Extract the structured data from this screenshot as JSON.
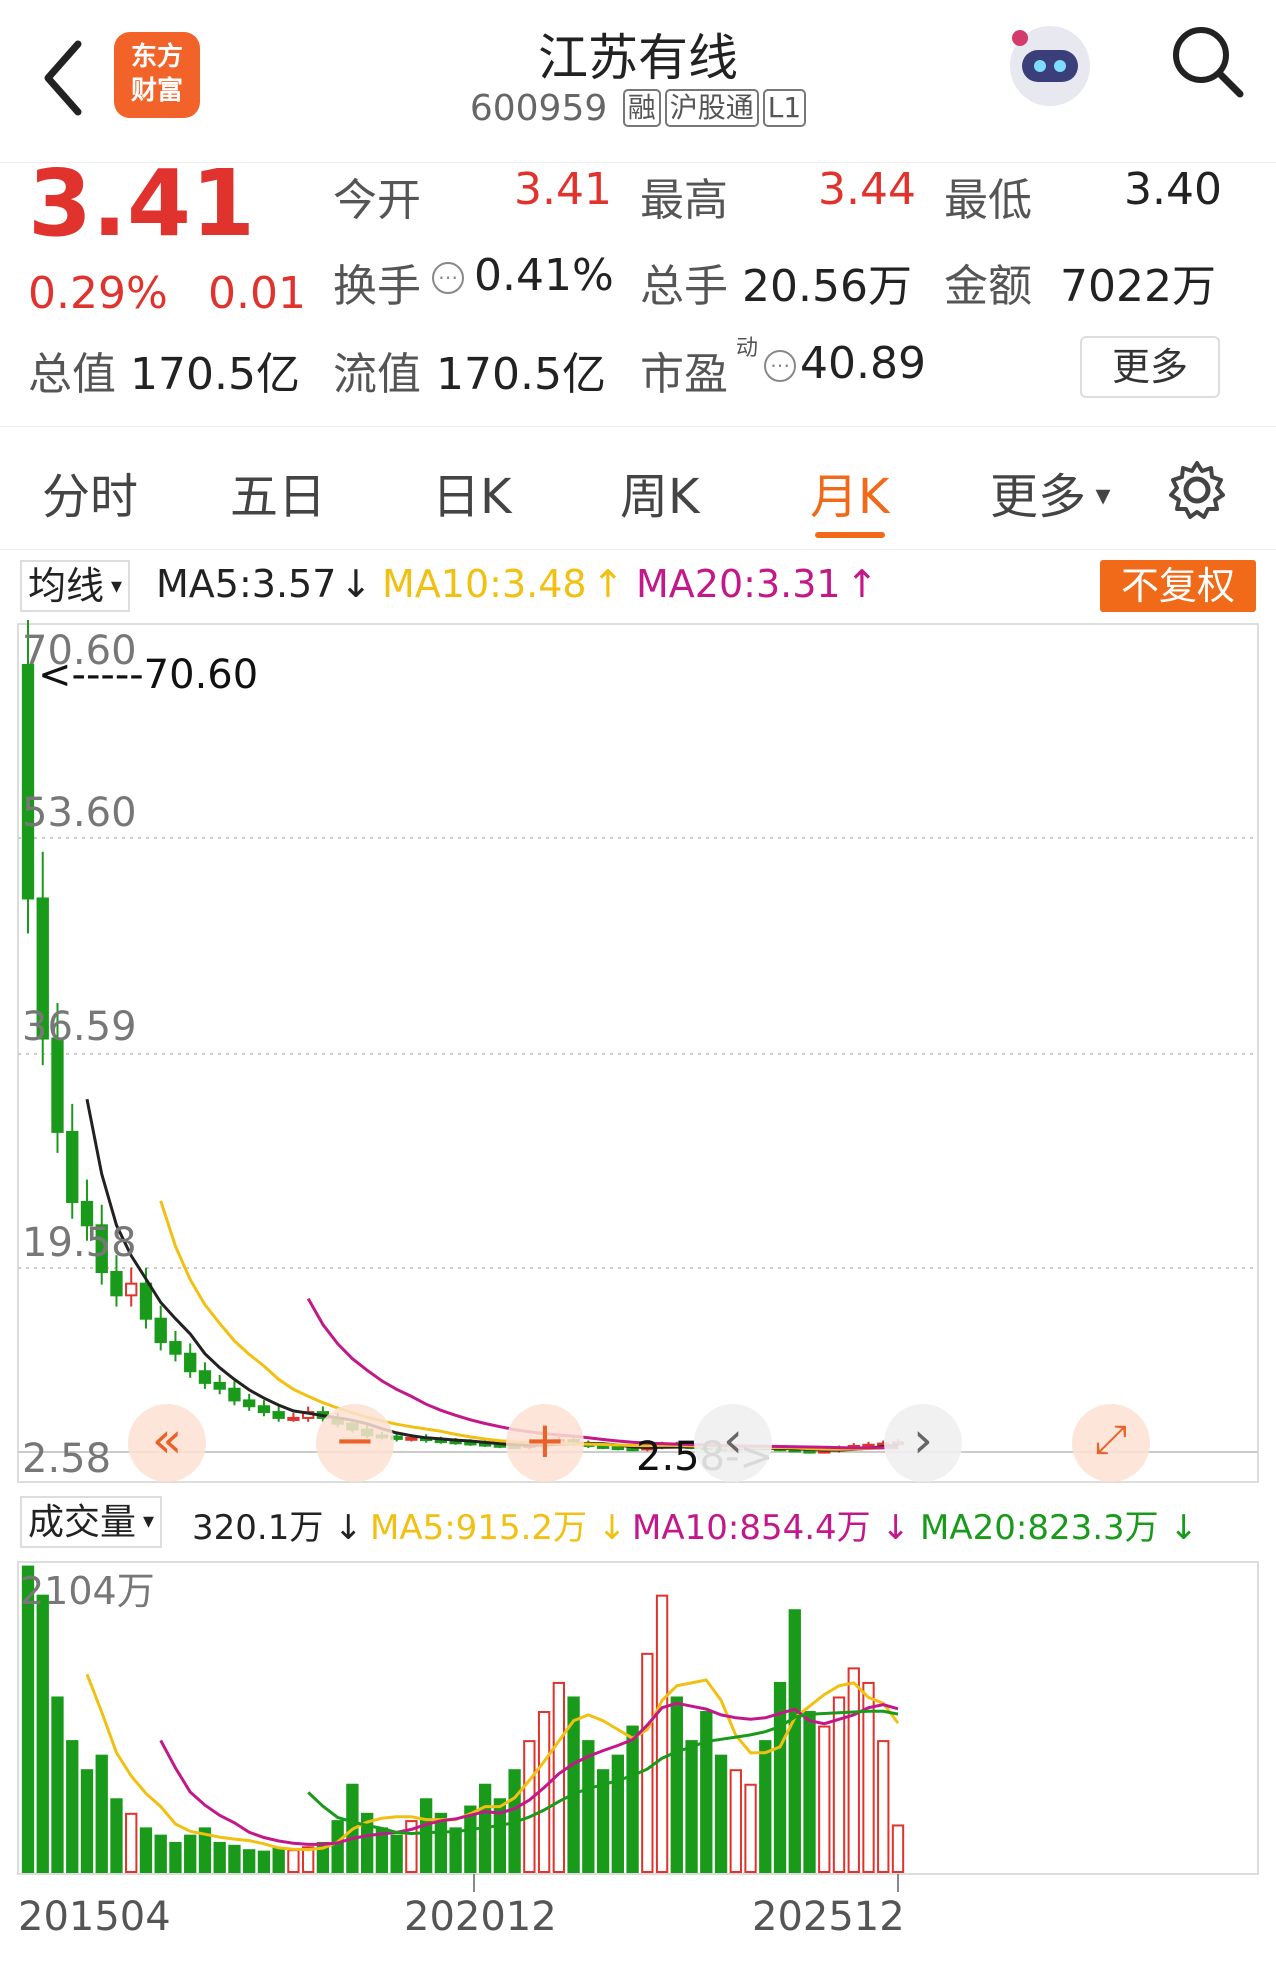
{
  "header": {
    "back_icon": "chevron-left-icon",
    "logo_lines": [
      "东方",
      "财富"
    ],
    "stock_name": "江苏有线",
    "stock_code": "600959",
    "tags": [
      "融",
      "沪股通",
      "L1"
    ],
    "robot_icon": "robot-avatar-icon",
    "search_icon": "search-icon"
  },
  "quote": {
    "price": "3.41",
    "change_pct": "0.29%",
    "change_abs": "0.01",
    "open_label": "今开",
    "open": "3.41",
    "high_label": "最高",
    "high": "3.44",
    "low_label": "最低",
    "low": "3.40",
    "turnover_label": "换手",
    "turnover": "0.41%",
    "volume_label": "总手",
    "volume": "20.56万",
    "amount_label": "金额",
    "amount": "7022万",
    "total_mv_label": "总值",
    "total_mv": "170.5亿",
    "float_mv_label": "流值",
    "float_mv": "170.5亿",
    "pe_label": "市盈",
    "pe_sup": "动",
    "pe": "40.89",
    "more_label": "更多"
  },
  "tabs": [
    "分时",
    "五日",
    "日K",
    "周K",
    "月K",
    "更多"
  ],
  "active_tab": "月K",
  "price_legend": {
    "selector": "均线",
    "ma5": "MA5:3.57",
    "ma10": "MA10:3.48",
    "ma20": "MA20:3.31",
    "adjust": "不复权",
    "colors": {
      "ma5": "#222222",
      "ma10": "#f2c012",
      "ma20": "#c2188a",
      "up": "#e0332d",
      "down": "#1a9a1a"
    }
  },
  "volume_legend": {
    "selector": "成交量",
    "vol": "320.1万",
    "ma5": "MA5:915.2万",
    "ma10": "MA10:854.4万",
    "ma20": "MA20:823.3万"
  },
  "chart_data": {
    "type": "candlestick",
    "y_ticks": [
      "70.60",
      "53.60",
      "36.59",
      "19.58",
      "2.58"
    ],
    "ylim": [
      2.58,
      70.6
    ],
    "max_marker": "<-----70.60",
    "min_marker": "2.58->",
    "volume_max_label": "2104万",
    "x_labels": [
      "201504",
      "202012",
      "202512"
    ],
    "close_series": [
      50,
      38,
      30,
      24,
      22,
      18,
      16,
      17,
      14,
      12,
      11,
      9.5,
      8.5,
      8,
      7,
      6.5,
      6,
      5.5,
      5.5,
      6,
      5.5,
      5,
      4.5,
      4,
      3.9,
      3.7,
      3.8,
      3.6,
      3.5,
      3.4,
      3.3,
      3.2,
      3.1,
      3.0,
      3.2,
      3.4,
      3.6,
      3.3,
      3.1,
      3.0,
      2.9,
      2.8,
      3.0,
      3.2,
      3.1,
      3.0,
      2.9,
      2.8,
      2.9,
      3.0,
      2.9,
      2.8,
      2.7,
      2.6,
      2.7,
      2.9,
      3.1,
      3.2,
      3.3,
      3.41
    ],
    "volume_series": [
      2100,
      1900,
      1200,
      900,
      700,
      800,
      500,
      400,
      300,
      250,
      200,
      250,
      300,
      200,
      180,
      150,
      140,
      160,
      150,
      170,
      200,
      350,
      600,
      400,
      300,
      250,
      350,
      500,
      400,
      300,
      450,
      600,
      500,
      700,
      900,
      1100,
      1300,
      1200,
      900,
      700,
      800,
      1000,
      1500,
      1900,
      1200,
      900,
      1100,
      800,
      700,
      600,
      900,
      1300,
      1800,
      1100,
      1000,
      1200,
      1400,
      1300,
      900,
      320
    ]
  },
  "controls": {
    "rewind_icon": "double-chevron-left-icon",
    "minus_icon": "zoom-out-icon",
    "plus_icon": "zoom-in-icon",
    "prev_icon": "chevron-left-icon",
    "next_icon": "chevron-right-icon",
    "expand_icon": "expand-icon"
  }
}
